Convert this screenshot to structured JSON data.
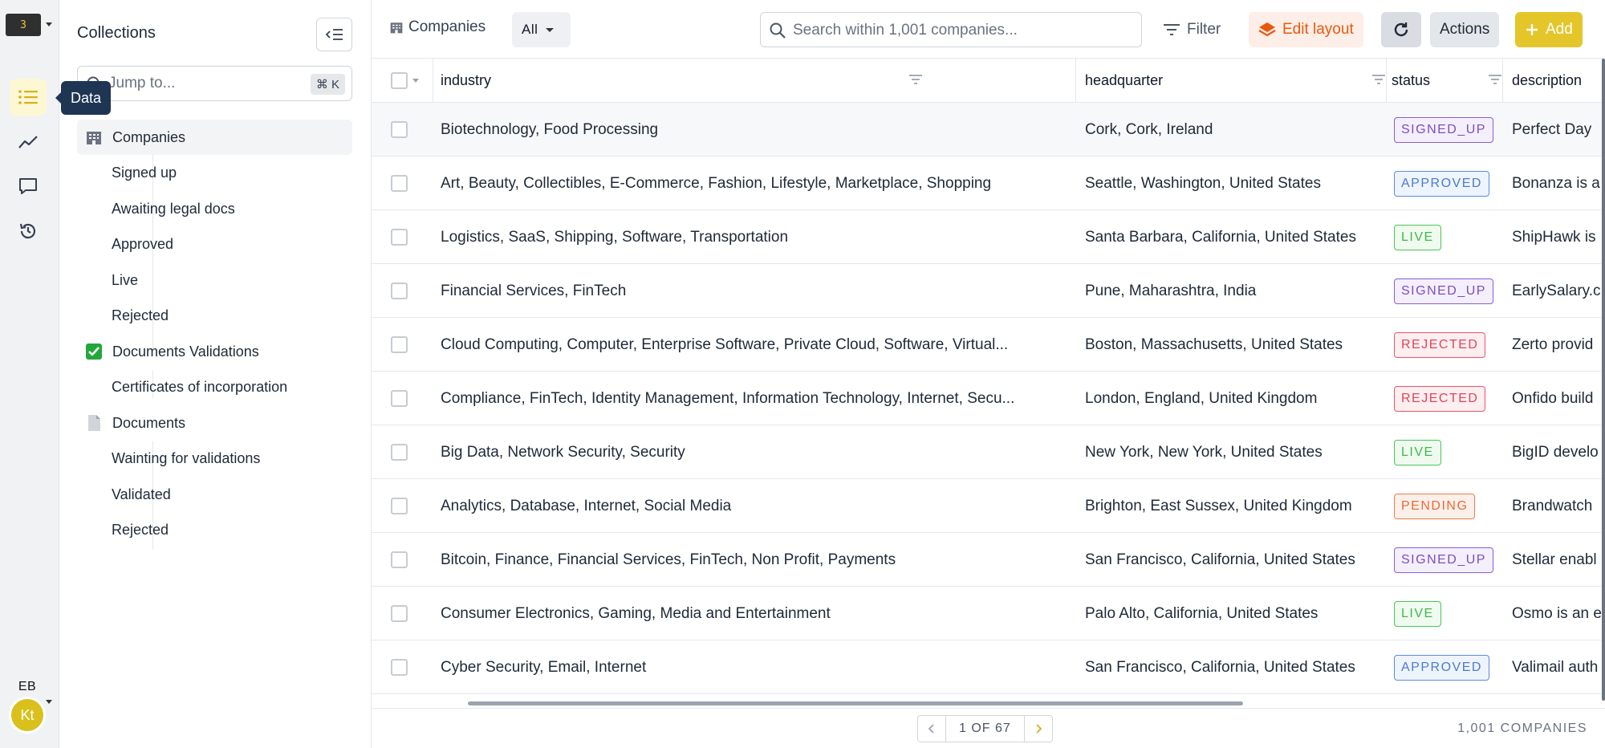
{
  "app": {
    "logo_text": "3",
    "tooltip": "Data",
    "users": {
      "initials_1": "EB",
      "initials_2": "Kt"
    }
  },
  "colors": {
    "accent": "#e4c62b",
    "edit_layout": "#ea580c",
    "tooltip_bg": "#1e3553"
  },
  "sidebar": {
    "title": "Collections",
    "jump_placeholder": "Jump to...",
    "jump_shortcut": "⌘ K",
    "items": [
      {
        "label": "Companies",
        "icon": "building-icon"
      },
      {
        "label": "Signed up"
      },
      {
        "label": "Awaiting legal docs"
      },
      {
        "label": "Approved"
      },
      {
        "label": "Live"
      },
      {
        "label": "Rejected"
      },
      {
        "label": "Documents Validations",
        "icon": "check-box-icon"
      },
      {
        "label": "Certificates of incorporation"
      },
      {
        "label": "Documents",
        "icon": "document-icon"
      },
      {
        "label": "Wainting for validations"
      },
      {
        "label": "Validated"
      },
      {
        "label": "Rejected"
      }
    ]
  },
  "toolbar": {
    "breadcrumb": "Companies",
    "view": "All",
    "search_placeholder": "Search within 1,001 companies...",
    "filter": "Filter",
    "edit_layout": "Edit layout",
    "actions": "Actions",
    "add": "Add"
  },
  "table": {
    "columns": [
      "industry",
      "headquarter",
      "status",
      "description"
    ],
    "rows": [
      {
        "industry": "Biotechnology, Food Processing",
        "headquarter": "Cork, Cork, Ireland",
        "status": "SIGNED_UP",
        "description": "Perfect Day"
      },
      {
        "industry": "Art, Beauty, Collectibles, E-Commerce, Fashion, Lifestyle, Marketplace, Shopping",
        "headquarter": "Seattle, Washington, United States",
        "status": "APPROVED",
        "description": "Bonanza is a"
      },
      {
        "industry": "Logistics, SaaS, Shipping, Software, Transportation",
        "headquarter": "Santa Barbara, California, United States",
        "status": "LIVE",
        "description": "ShipHawk is"
      },
      {
        "industry": "Financial Services, FinTech",
        "headquarter": "Pune, Maharashtra, India",
        "status": "SIGNED_UP",
        "description": "EarlySalary.c"
      },
      {
        "industry": "Cloud Computing, Computer, Enterprise Software, Private Cloud, Software, Virtual...",
        "headquarter": "Boston, Massachusetts, United States",
        "status": "REJECTED",
        "description": "Zerto provid"
      },
      {
        "industry": "Compliance, FinTech, Identity Management, Information Technology, Internet, Secu...",
        "headquarter": "London, England, United Kingdom",
        "status": "REJECTED",
        "description": "Onfido build"
      },
      {
        "industry": "Big Data, Network Security, Security",
        "headquarter": "New York, New York, United States",
        "status": "LIVE",
        "description": "BigID develo"
      },
      {
        "industry": "Analytics, Database, Internet, Social Media",
        "headquarter": "Brighton, East Sussex, United Kingdom",
        "status": "PENDING",
        "description": "Brandwatch"
      },
      {
        "industry": "Bitcoin, Finance, Financial Services, FinTech, Non Profit, Payments",
        "headquarter": "San Francisco, California, United States",
        "status": "SIGNED_UP",
        "description": "Stellar enabl"
      },
      {
        "industry": "Consumer Electronics, Gaming, Media and Entertainment",
        "headquarter": "Palo Alto, California, United States",
        "status": "LIVE",
        "description": "Osmo is an e"
      },
      {
        "industry": "Cyber Security, Email, Internet",
        "headquarter": "San Francisco, California, United States",
        "status": "APPROVED",
        "description": "Valimail auth"
      }
    ]
  },
  "footer": {
    "page_label": "1 OF 67",
    "count": "1,001 COMPANIES"
  }
}
